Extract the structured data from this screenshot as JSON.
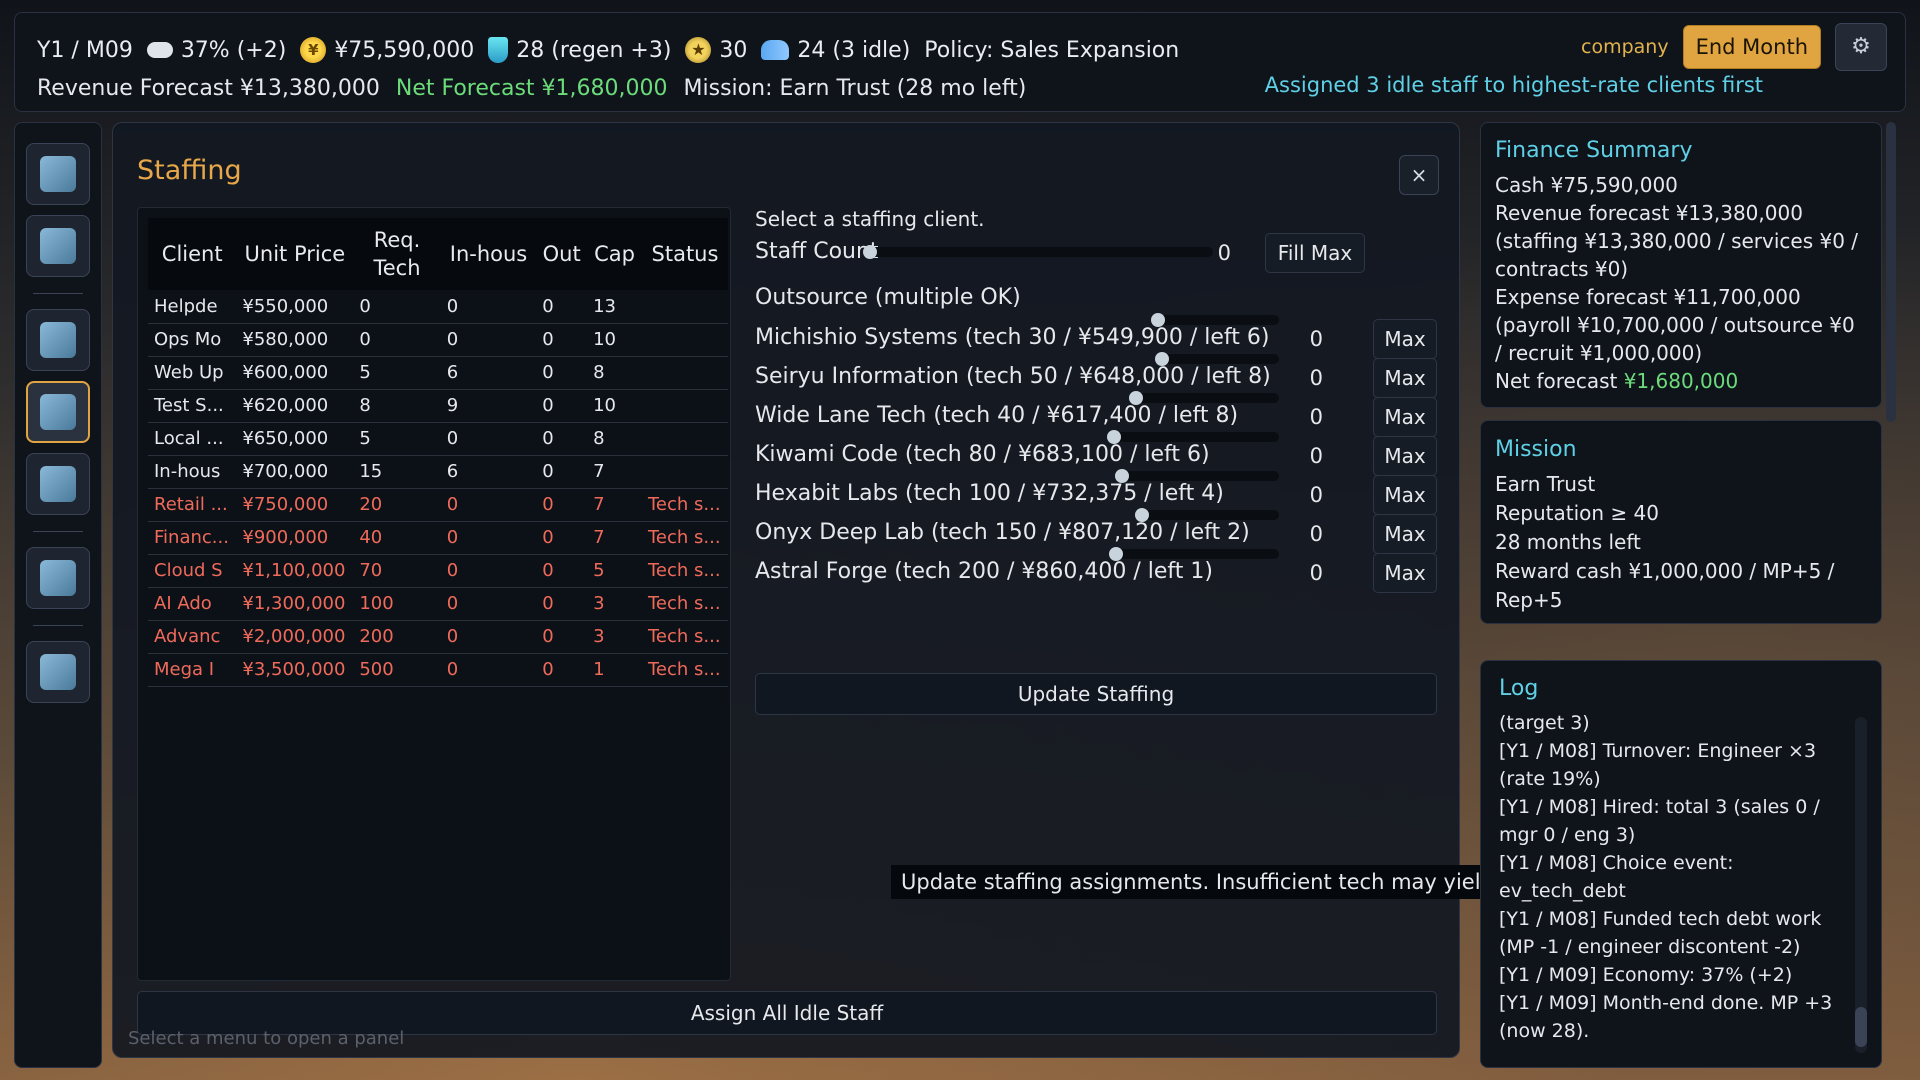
{
  "topbar": {
    "date": "Y1 / M09",
    "economy": "37% (+2)",
    "cash": "¥75,590,000",
    "mp": "28 (regen +3)",
    "reputation": "30",
    "staff": "24 (3 idle)",
    "policy": "Policy: Sales Expansion",
    "company_label": "company",
    "end_month_label": "End Month",
    "revenue_forecast": "Revenue Forecast ¥13,380,000",
    "net_forecast": "Net Forecast ¥1,680,000",
    "mission": "Mission: Earn Trust (28 mo left)",
    "assign_msg": "Assigned 3 idle staff to highest-rate clients first"
  },
  "sidebar": {
    "items": [
      "market-chart",
      "growth-chart",
      "clipboard",
      "staff",
      "factory",
      "handshake",
      "tools"
    ],
    "active": "staff"
  },
  "staffing": {
    "title": "Staffing",
    "close_label": "×",
    "table": {
      "headers": [
        "Client",
        "Unit Price",
        "Req. Tech",
        "In-hous",
        "Out",
        "Cap",
        "Status"
      ],
      "rows": [
        {
          "client": "Helpde",
          "price": "¥550,000",
          "tech": "0",
          "inhouse": "0",
          "out": "0",
          "cap": "13",
          "status": "",
          "locked": false
        },
        {
          "client": "Ops Mo",
          "price": "¥580,000",
          "tech": "0",
          "inhouse": "0",
          "out": "0",
          "cap": "10",
          "status": "",
          "locked": false
        },
        {
          "client": "Web Up",
          "price": "¥600,000",
          "tech": "5",
          "inhouse": "6",
          "out": "0",
          "cap": "8",
          "status": "",
          "locked": false
        },
        {
          "client": "Test S...",
          "price": "¥620,000",
          "tech": "8",
          "inhouse": "9",
          "out": "0",
          "cap": "10",
          "status": "",
          "locked": false
        },
        {
          "client": "Local ...",
          "price": "¥650,000",
          "tech": "5",
          "inhouse": "0",
          "out": "0",
          "cap": "8",
          "status": "",
          "locked": false
        },
        {
          "client": "In-hous",
          "price": "¥700,000",
          "tech": "15",
          "inhouse": "6",
          "out": "0",
          "cap": "7",
          "status": "",
          "locked": false
        },
        {
          "client": "Retail ...",
          "price": "¥750,000",
          "tech": "20",
          "inhouse": "0",
          "out": "0",
          "cap": "7",
          "status": "Tech s...",
          "locked": true
        },
        {
          "client": "Financ...",
          "price": "¥900,000",
          "tech": "40",
          "inhouse": "0",
          "out": "0",
          "cap": "7",
          "status": "Tech s...",
          "locked": true
        },
        {
          "client": "Cloud S",
          "price": "¥1,100,000",
          "tech": "70",
          "inhouse": "0",
          "out": "0",
          "cap": "5",
          "status": "Tech s...",
          "locked": true
        },
        {
          "client": "AI Ado",
          "price": "¥1,300,000",
          "tech": "100",
          "inhouse": "0",
          "out": "0",
          "cap": "3",
          "status": "Tech s...",
          "locked": true
        },
        {
          "client": "Advanc",
          "price": "¥2,000,000",
          "tech": "200",
          "inhouse": "0",
          "out": "0",
          "cap": "3",
          "status": "Tech s...",
          "locked": true
        },
        {
          "client": "Mega I",
          "price": "¥3,500,000",
          "tech": "500",
          "inhouse": "0",
          "out": "0",
          "cap": "1",
          "status": "Tech s...",
          "locked": true
        }
      ]
    },
    "select_hint": "Select a staffing client.",
    "staff_count_label": "Staff Count",
    "staff_count_value": "0",
    "fill_max_label": "Fill Max",
    "outsource_label": "Outsource (multiple OK)",
    "outsource": [
      {
        "label": "Michishio Systems (tech 30 / ¥549,900 / left 6)",
        "value": "0"
      },
      {
        "label": "Seiryu Information (tech 50 / ¥648,000 / left 8)",
        "value": "0"
      },
      {
        "label": "Wide Lane Tech (tech 40 / ¥617,400 / left 8)",
        "value": "0"
      },
      {
        "label": "Kiwami Code (tech 80 / ¥683,100 / left 6)",
        "value": "0"
      },
      {
        "label": "Hexabit Labs (tech 100 / ¥732,375 / left 4)",
        "value": "0"
      },
      {
        "label": "Onyx Deep Lab (tech 150 / ¥807,120 / left 2)",
        "value": "0"
      },
      {
        "label": "Astral Forge (tech 200 / ¥860,400 / left 1)",
        "value": "0"
      }
    ],
    "max_label": "Max",
    "update_label": "Update Staffing",
    "tooltip": "Update staffing assignments. Insufficient tech may yield no revenue.",
    "assign_all_label": "Assign All Idle Staff",
    "menu_hint": "Select a menu to open a panel"
  },
  "finance": {
    "title": "Finance Summary",
    "cash": "Cash ¥75,590,000",
    "revenue": "Revenue forecast ¥13,380,000",
    "revenue_detail": "(staffing ¥13,380,000 / services ¥0 / contracts ¥0)",
    "expense": "Expense forecast ¥11,700,000 (payroll ¥10,700,000 / outsource ¥0 / recruit ¥1,000,000)",
    "net_label": "Net forecast",
    "net_value": "¥1,680,000"
  },
  "mission_panel": {
    "title": "Mission",
    "name": "Earn Trust",
    "req": "Reputation ≥ 40",
    "time": "28 months left",
    "reward": "Reward cash ¥1,000,000 / MP+5 / Rep+5"
  },
  "log": {
    "title": "Log",
    "entries": [
      "(target 3)",
      "[Y1 / M08] Turnover: Engineer ×3 (rate 19%)",
      "[Y1 / M08] Hired: total 3 (sales 0 / mgr 0 / eng 3)",
      "[Y1 / M08] Choice event: ev_tech_debt",
      "[Y1 / M08] Funded tech debt work (MP -1 / engineer discontent -2)",
      "[Y1 / M09] Economy: 37% (+2)",
      "[Y1 / M09] Month-end done. MP +3 (now 28)."
    ]
  }
}
